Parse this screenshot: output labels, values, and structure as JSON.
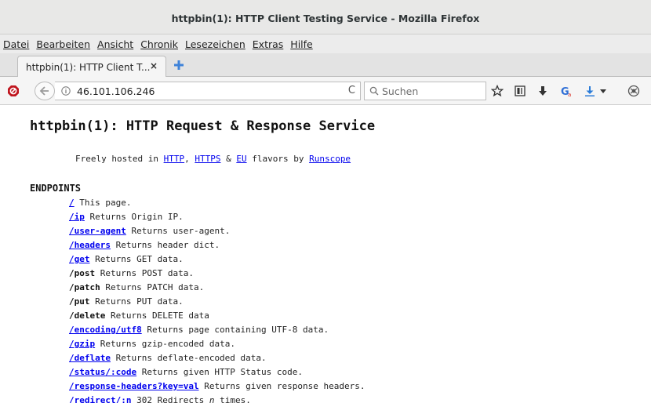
{
  "window": {
    "title": "httpbin(1): HTTP Client Testing Service - Mozilla Firefox"
  },
  "menubar": {
    "items": [
      {
        "label": "Datei"
      },
      {
        "label": "Bearbeiten"
      },
      {
        "label": "Ansicht"
      },
      {
        "label": "Chronik"
      },
      {
        "label": "Lesezeichen"
      },
      {
        "label": "Extras"
      },
      {
        "label": "Hilfe"
      }
    ]
  },
  "tab": {
    "label": "httpbin(1): HTTP Client T...",
    "close": "×"
  },
  "navbar": {
    "url": "46.101.106.246",
    "search_placeholder": "Suchen",
    "reload_glyph": "C"
  },
  "page": {
    "title": "httpbin(1): HTTP Request & Response Service",
    "subtitle": {
      "prefix": "Freely hosted in ",
      "link_http": "HTTP",
      "sep1": ", ",
      "link_https": "HTTPS",
      "sep2": " & ",
      "link_eu": "EU",
      "mid": " flavors by ",
      "link_runscope": "Runscope"
    },
    "section_heading": "ENDPOINTS",
    "endpoints": [
      {
        "path": "/",
        "desc": "This page."
      },
      {
        "path": "/ip",
        "desc": "Returns Origin IP."
      },
      {
        "path": "/user-agent",
        "desc": "Returns user-agent."
      },
      {
        "path": "/headers",
        "desc": "Returns header dict."
      },
      {
        "path": "/get",
        "desc": "Returns GET data."
      },
      {
        "path": "/post",
        "desc": "Returns POST data."
      },
      {
        "path": "/patch",
        "desc": "Returns PATCH data."
      },
      {
        "path": "/put",
        "desc": "Returns PUT data."
      },
      {
        "path": "/delete",
        "desc": "Returns DELETE data"
      },
      {
        "path": "/encoding/utf8",
        "desc": "Returns page containing UTF-8 data."
      },
      {
        "path": "/gzip",
        "desc": "Returns gzip-encoded data."
      },
      {
        "path": "/deflate",
        "desc": "Returns deflate-encoded data."
      },
      {
        "path": "/status/:code",
        "desc": "Returns given HTTP Status code."
      },
      {
        "path": "/response-headers?key=val",
        "desc": "Returns given response headers."
      },
      {
        "path": "/redirect/:n",
        "desc_pre": "302 Redirects ",
        "desc_em": "n",
        "desc_post": " times."
      }
    ]
  },
  "colors": {
    "link": "#0000ee",
    "chrome": "#e8e8e7",
    "ublock_red": "#c0161f"
  }
}
